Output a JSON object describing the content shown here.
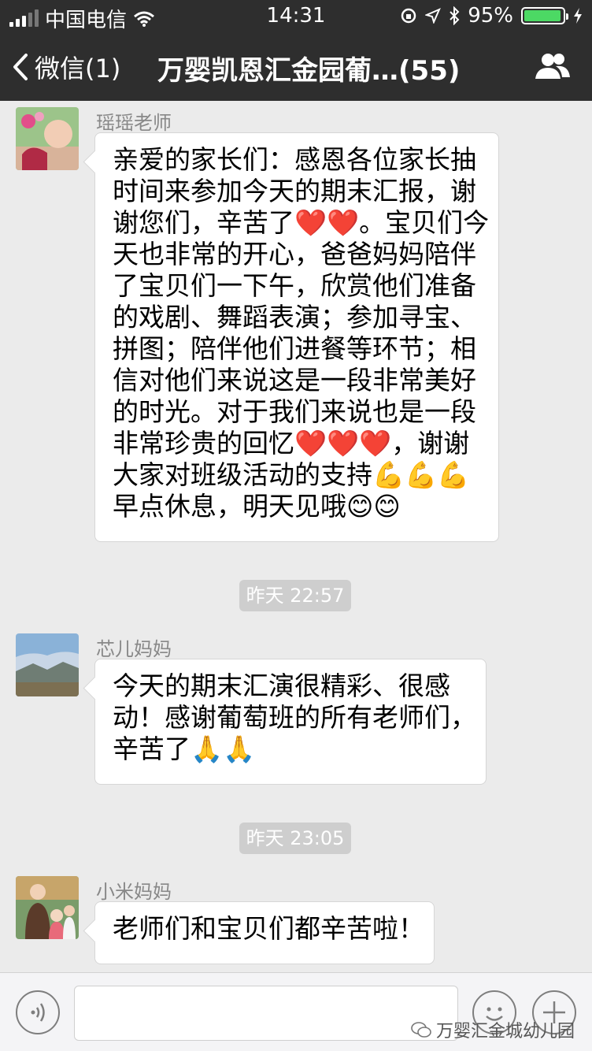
{
  "status_bar": {
    "carrier": "中国电信",
    "time": "14:31",
    "battery_percent": "95%",
    "battery_level": 0.95
  },
  "nav": {
    "back_label": "微信(1)",
    "title": "万婴凯恩汇金园葡…(55)"
  },
  "messages": [
    {
      "sender": "瑶瑶老师",
      "lines": [
        "亲爱的家长们：感恩各位家长抽",
        "时间来参加今天的期末汇报，谢",
        "谢您们，辛苦了❤️❤️。宝贝们今",
        "天也非常的开心，爸爸妈妈陪伴",
        "了宝贝们一下午，欣赏他们准备",
        "的戏剧、舞蹈表演；参加寻宝、",
        "拼图；陪伴他们进餐等环节；相",
        "信对他们来说这是一段非常美好",
        "的时光。对于我们来说也是一段",
        "非常珍贵的回忆❤️❤️❤️，谢谢",
        "大家对班级活动的支持💪💪💪",
        "早点休息，明天见哦😊😊"
      ]
    },
    {
      "timestamp": "昨天 22:57"
    },
    {
      "sender": "芯儿妈妈",
      "lines": [
        "今天的期末汇演很精彩、很感",
        "动！感谢葡萄班的所有老师们，",
        "辛苦了🙏🙏"
      ]
    },
    {
      "timestamp": "昨天 23:05"
    },
    {
      "sender": "小米妈妈",
      "lines": [
        "老师们和宝贝们都辛苦啦！"
      ]
    }
  ],
  "watermark": "万婴汇金城幼儿园",
  "colors": {
    "bar_bg": "#2e2e2e",
    "chat_bg": "#ebebeb",
    "timestamp_bg": "#cecece",
    "battery_green": "#4cd964"
  }
}
